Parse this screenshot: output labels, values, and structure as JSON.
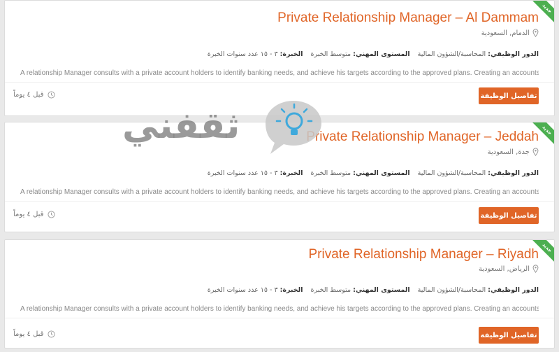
{
  "ribbon_label": "جديد",
  "jobs": [
    {
      "title": "Private Relationship Manager – Al Dammam",
      "location": "الدمام, السعودية",
      "role_label": "الدور الوظيفي:",
      "role_value": "المحاسبة/الشؤون المالية",
      "level_label": "المستوى المهني:",
      "level_value": "متوسط الخبرة",
      "exp_label": "الخبرة:",
      "exp_value": "٣ - ١٥ عدد سنوات الخبرة",
      "description": "A relationship Manager consults with a private account holders to identify banking needs, and achieve his targets according to the approved plans. Creating an accounts for...",
      "button": "تفاصيل الوظيفة",
      "posted": "قبل ٤ يوماً"
    },
    {
      "title": "Private Relationship Manager – Jeddah",
      "location": "جدة, السعودية",
      "role_label": "الدور الوظيفي:",
      "role_value": "المحاسبة/الشؤون المالية",
      "level_label": "المستوى المهني:",
      "level_value": "متوسط الخبرة",
      "exp_label": "الخبرة:",
      "exp_value": "٣ - ١٥ عدد سنوات الخبرة",
      "description": "A relationship Manager consults with a private account holders to identify banking needs, and achieve his targets according to the approved plans. Creating an accounts for...",
      "button": "تفاصيل الوظيفة",
      "posted": "قبل ٤ يوماً"
    },
    {
      "title": "Private Relationship Manager – Riyadh",
      "location": "الرياض, السعودية",
      "role_label": "الدور الوظيفي:",
      "role_value": "المحاسبة/الشؤون المالية",
      "level_label": "المستوى المهني:",
      "level_value": "متوسط الخبرة",
      "exp_label": "الخبرة:",
      "exp_value": "٣ - ١٥ عدد سنوات الخبرة",
      "description": "A relationship Manager consults with a private account holders to identify banking needs, and achieve his targets according to the approved plans. Creating an accounts for...",
      "button": "تفاصيل الوظيفة",
      "posted": "قبل ٤ يوماً"
    }
  ],
  "watermark_text": "ثقفني",
  "icons": {
    "location": "location-pin-icon",
    "clock": "clock-icon",
    "watermark": "lightbulb-icon"
  },
  "colors": {
    "accent": "#e06527",
    "ribbon": "#4caf50"
  }
}
